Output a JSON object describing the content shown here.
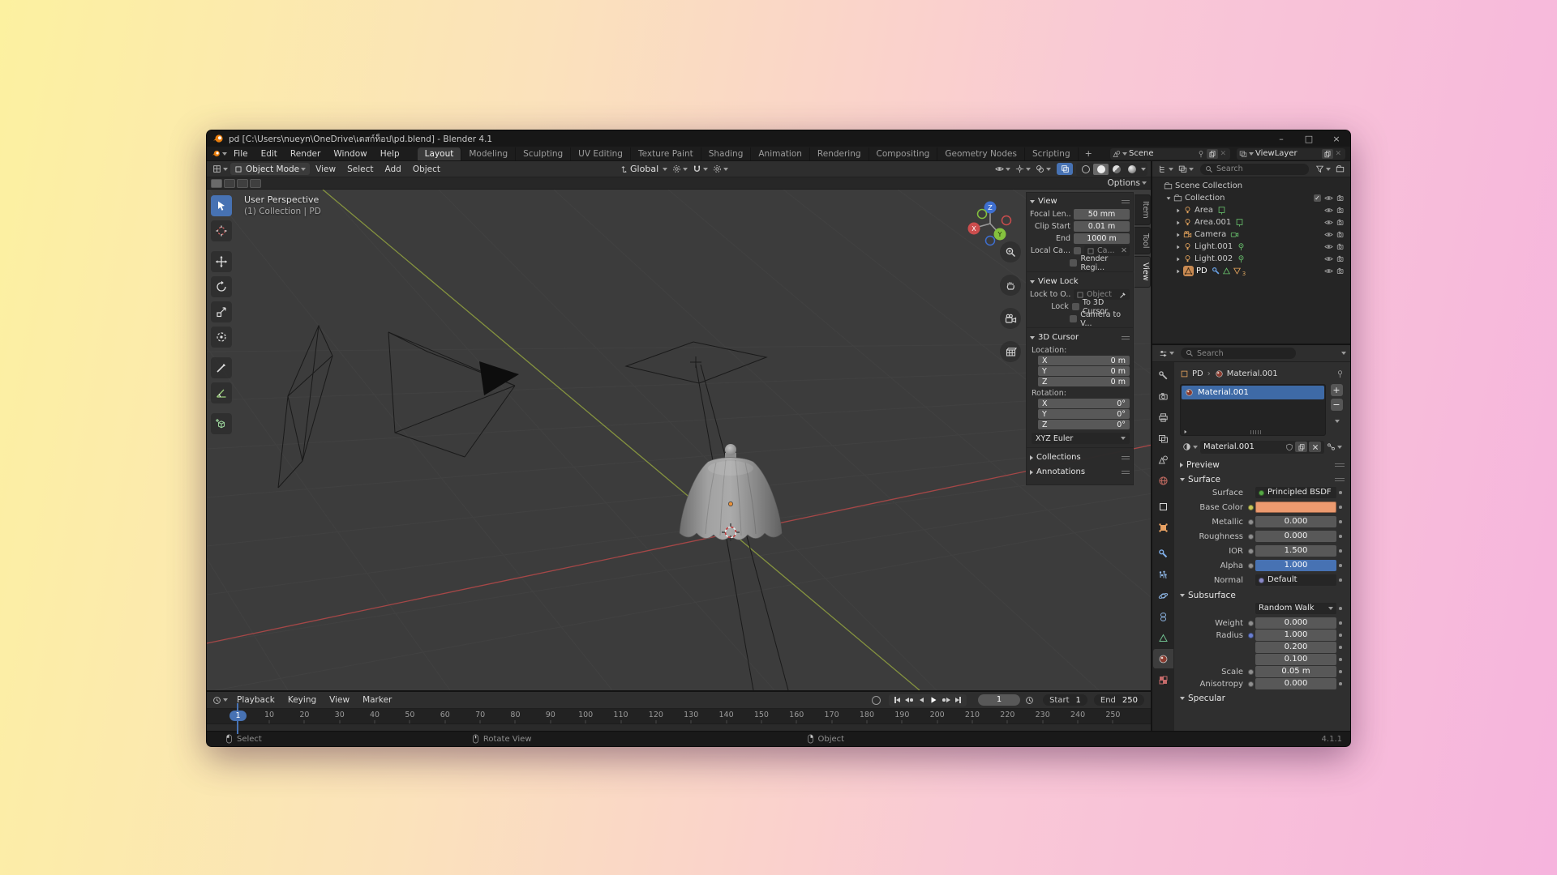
{
  "window": {
    "title": "pd [C:\\Users\\nueyn\\OneDrive\\เดสก์ท็อป\\pd.blend] - Blender 4.1",
    "controls": {
      "minimize": "–",
      "maximize": "□",
      "close": "×"
    }
  },
  "menubar": {
    "menus": [
      "File",
      "Edit",
      "Render",
      "Window",
      "Help"
    ]
  },
  "workspaces": {
    "tabs": [
      "Layout",
      "Modeling",
      "Sculpting",
      "UV Editing",
      "Texture Paint",
      "Shading",
      "Animation",
      "Rendering",
      "Compositing",
      "Geometry Nodes",
      "Scripting"
    ],
    "active": "Layout",
    "add_label": "+"
  },
  "scene_selector": {
    "label": "Scene"
  },
  "viewlayer_selector": {
    "label": "ViewLayer"
  },
  "viewport": {
    "header": {
      "mode": "Object Mode",
      "menus": [
        "View",
        "Select",
        "Add",
        "Object"
      ],
      "orientation": "Global",
      "options_label": "Options"
    },
    "overlay": {
      "line1": "User Perspective",
      "line2": "(1) Collection | PD"
    },
    "gizmo": {
      "x": "X",
      "y": "Y",
      "z": "Z"
    }
  },
  "sidebar": {
    "tabs": [
      "Item",
      "Tool",
      "View"
    ],
    "active_tab": "View",
    "view_panel": {
      "title": "View",
      "fields": [
        {
          "label": "Focal Len...",
          "value": "50 mm"
        },
        {
          "label": "Clip Start",
          "value": "0.01 m"
        },
        {
          "label": "End",
          "value": "1000 m"
        }
      ],
      "local_camera_label": "Local Ca...",
      "local_camera_value": "Ca...",
      "render_region": "Render Regi..."
    },
    "view_lock": {
      "title": "View Lock",
      "lock_to_label": "Lock to O...",
      "object_placeholder": "Object",
      "lock_label": "Lock",
      "to_cursor": "To 3D Cursor",
      "camera_to_view": "Camera to V..."
    },
    "cursor_panel": {
      "title": "3D Cursor",
      "location_label": "Location:",
      "rotation_label": "Rotation:",
      "location": [
        {
          "axis": "X",
          "value": "0 m"
        },
        {
          "axis": "Y",
          "value": "0 m"
        },
        {
          "axis": "Z",
          "value": "0 m"
        }
      ],
      "rotation": [
        {
          "axis": "X",
          "value": "0°"
        },
        {
          "axis": "Y",
          "value": "0°"
        },
        {
          "axis": "Z",
          "value": "0°"
        }
      ],
      "euler": "XYZ Euler"
    },
    "collapsed": [
      "Collections",
      "Annotations"
    ]
  },
  "outliner": {
    "search_placeholder": "Search",
    "rows": [
      {
        "name": "Scene Collection",
        "icon": "scene-collection",
        "level": 0,
        "vis": false
      },
      {
        "name": "Collection",
        "icon": "collection",
        "level": 1,
        "expanded": true,
        "checkbox": true,
        "vis": true
      },
      {
        "name": "Area",
        "icon": "light",
        "data_icon": "area-data",
        "level": 2,
        "vis": true
      },
      {
        "name": "Area.001",
        "icon": "light",
        "data_icon": "area-data",
        "level": 2,
        "vis": true
      },
      {
        "name": "Camera",
        "icon": "camera",
        "data_icon": "camera-data",
        "level": 2,
        "vis": true
      },
      {
        "name": "Light.001",
        "icon": "light",
        "data_icon": "point-data",
        "level": 2,
        "vis": true
      },
      {
        "name": "Light.002",
        "icon": "light",
        "data_icon": "point-data",
        "level": 2,
        "vis": true
      },
      {
        "name": "PD",
        "icon": "mesh",
        "level": 2,
        "selected": true,
        "extra": [
          "wrench",
          "mesh-data",
          "material"
        ],
        "mat_count": "3",
        "vis": true
      }
    ]
  },
  "properties": {
    "search_placeholder": "Search",
    "tabs": [
      "tool",
      "render",
      "output",
      "viewlayer",
      "scene",
      "world",
      "object",
      "object-props",
      "modifiers",
      "particles",
      "physics",
      "constraints",
      "data",
      "material",
      "texture"
    ],
    "active_tab": "material",
    "breadcrumb": {
      "object": "PD",
      "data": "Material.001"
    },
    "slot_name": "Material.001",
    "material_name": "Material.001",
    "preview_title": "Preview",
    "surface_title": "Surface",
    "surface_rows": [
      {
        "label": "Surface",
        "value": "Principled BSDF",
        "type": "text",
        "dot": "#56a845"
      },
      {
        "label": "Base Color",
        "value": "",
        "type": "color",
        "swatch": "#EC9A6F",
        "dot": "#c7c75a"
      },
      {
        "label": "Metallic",
        "value": "0.000",
        "type": "field",
        "dot": "#8f8f8f"
      },
      {
        "label": "Roughness",
        "value": "0.000",
        "type": "field",
        "dot": "#8f8f8f"
      },
      {
        "label": "IOR",
        "value": "1.500",
        "type": "field",
        "dot": "#8f8f8f"
      },
      {
        "label": "Alpha",
        "value": "1.000",
        "type": "slider",
        "dot": "#8f8f8f"
      },
      {
        "label": "Normal",
        "value": "Default",
        "type": "text",
        "dot": "#8a8ac8"
      }
    ],
    "subsurface_title": "Subsurface",
    "subsurface_method": "Random Walk",
    "subsurface_rows": [
      {
        "label": "Weight",
        "value": "0.000",
        "type": "field",
        "dot": "#8f8f8f"
      },
      {
        "label": "Radius",
        "value": "1.000",
        "type": "field",
        "dot": "#6a7fd0"
      },
      {
        "label": "",
        "value": "0.200",
        "type": "field"
      },
      {
        "label": "",
        "value": "0.100",
        "type": "field"
      },
      {
        "label": "Scale",
        "value": "0.05 m",
        "type": "field",
        "dot": "#8f8f8f"
      },
      {
        "label": "Anisotropy",
        "value": "0.000",
        "type": "field",
        "dot": "#8f8f8f"
      }
    ],
    "specular_title": "Specular"
  },
  "timeline": {
    "menus": [
      "Playback",
      "Keying",
      "View",
      "Marker"
    ],
    "current_frame": "1",
    "start_label": "Start",
    "start": "1",
    "end_label": "End",
    "end": "250",
    "frames": [
      10,
      20,
      30,
      40,
      50,
      60,
      70,
      80,
      90,
      100,
      110,
      120,
      130,
      140,
      150,
      160,
      170,
      180,
      190,
      200,
      210,
      220,
      230,
      240,
      250
    ]
  },
  "statusbar": {
    "hints": [
      {
        "button": "left",
        "label": "Select"
      },
      {
        "button": "middle",
        "label": "Rotate View"
      },
      {
        "button": "right",
        "label": "Object"
      }
    ],
    "version": "4.1.1"
  },
  "colors": {
    "accent": "#4772B3",
    "base_color": "#EC9A6F",
    "selection": "#3E6AA6"
  }
}
